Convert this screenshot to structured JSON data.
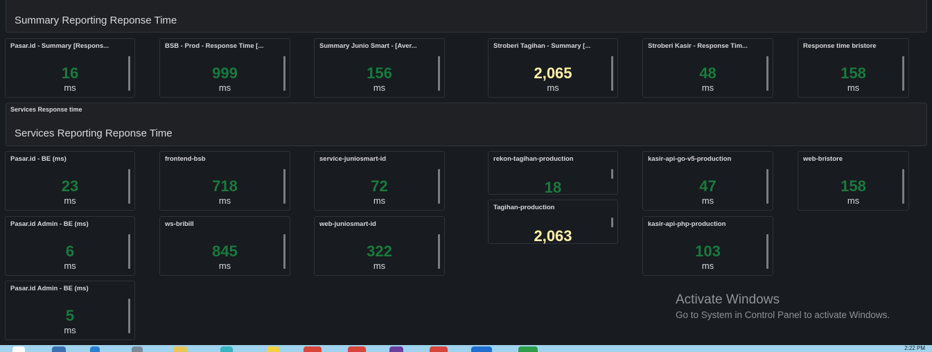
{
  "rows": {
    "summary": {
      "big_title": "Summary Reporting Reponse Time"
    },
    "services": {
      "small_title": "Services Response time",
      "big_title": "Services Reporting Reponse Time"
    }
  },
  "summary_panels": [
    {
      "title": "Pasar.id - Summary [Respons...",
      "value": "16",
      "unit": "ms",
      "color": "green"
    },
    {
      "title": "BSB - Prod - Response Time [...",
      "value": "999",
      "unit": "ms",
      "color": "green"
    },
    {
      "title": "Summary Junio Smart - [Aver...",
      "value": "156",
      "unit": "ms",
      "color": "green"
    },
    {
      "title": "Stroberi Tagihan - Summary [...",
      "value": "2,065",
      "unit": "ms",
      "color": "yellow"
    },
    {
      "title": "Stroberi Kasir - Response Tim...",
      "value": "48",
      "unit": "ms",
      "color": "green"
    },
    {
      "title": "Response time bristore",
      "value": "158",
      "unit": "ms",
      "color": "green"
    }
  ],
  "service_panels": [
    {
      "title": "Pasar.id - BE (ms)",
      "value": "23",
      "unit": "ms"
    },
    {
      "title": "frontend-bsb",
      "value": "718",
      "unit": "ms"
    },
    {
      "title": "service-juniosmart-id",
      "value": "72",
      "unit": "ms"
    },
    {
      "title": "rekon-tagihan-production",
      "value": "18",
      "unit": ""
    },
    {
      "title": "kasir-api-go-v5-production",
      "value": "47",
      "unit": "ms"
    },
    {
      "title": "web-bristore",
      "value": "158",
      "unit": "ms"
    },
    {
      "title": "Tagihan-production",
      "value": "2,063",
      "unit": ""
    },
    {
      "title": "Pasar.id Admin - BE (ms)",
      "value": "6",
      "unit": "ms"
    },
    {
      "title": "ws-bribill",
      "value": "845",
      "unit": "ms"
    },
    {
      "title": "web-juniosmart-id",
      "value": "322",
      "unit": "ms"
    },
    {
      "title": "kasir-api-php-production",
      "value": "103",
      "unit": "ms"
    },
    {
      "title": "Pasar.id Admin - BE (ms)",
      "value": "5",
      "unit": "ms"
    }
  ],
  "watermark": {
    "title": "Activate Windows",
    "subtitle": "Go to System in Control Panel to activate Windows."
  },
  "taskbar": {
    "clock": "2:22 PM"
  },
  "colors": {
    "green": "#1a7a3e",
    "yellow": "#fff1a8",
    "background": "#181b1f",
    "taskbar": "#9fd3ee"
  }
}
